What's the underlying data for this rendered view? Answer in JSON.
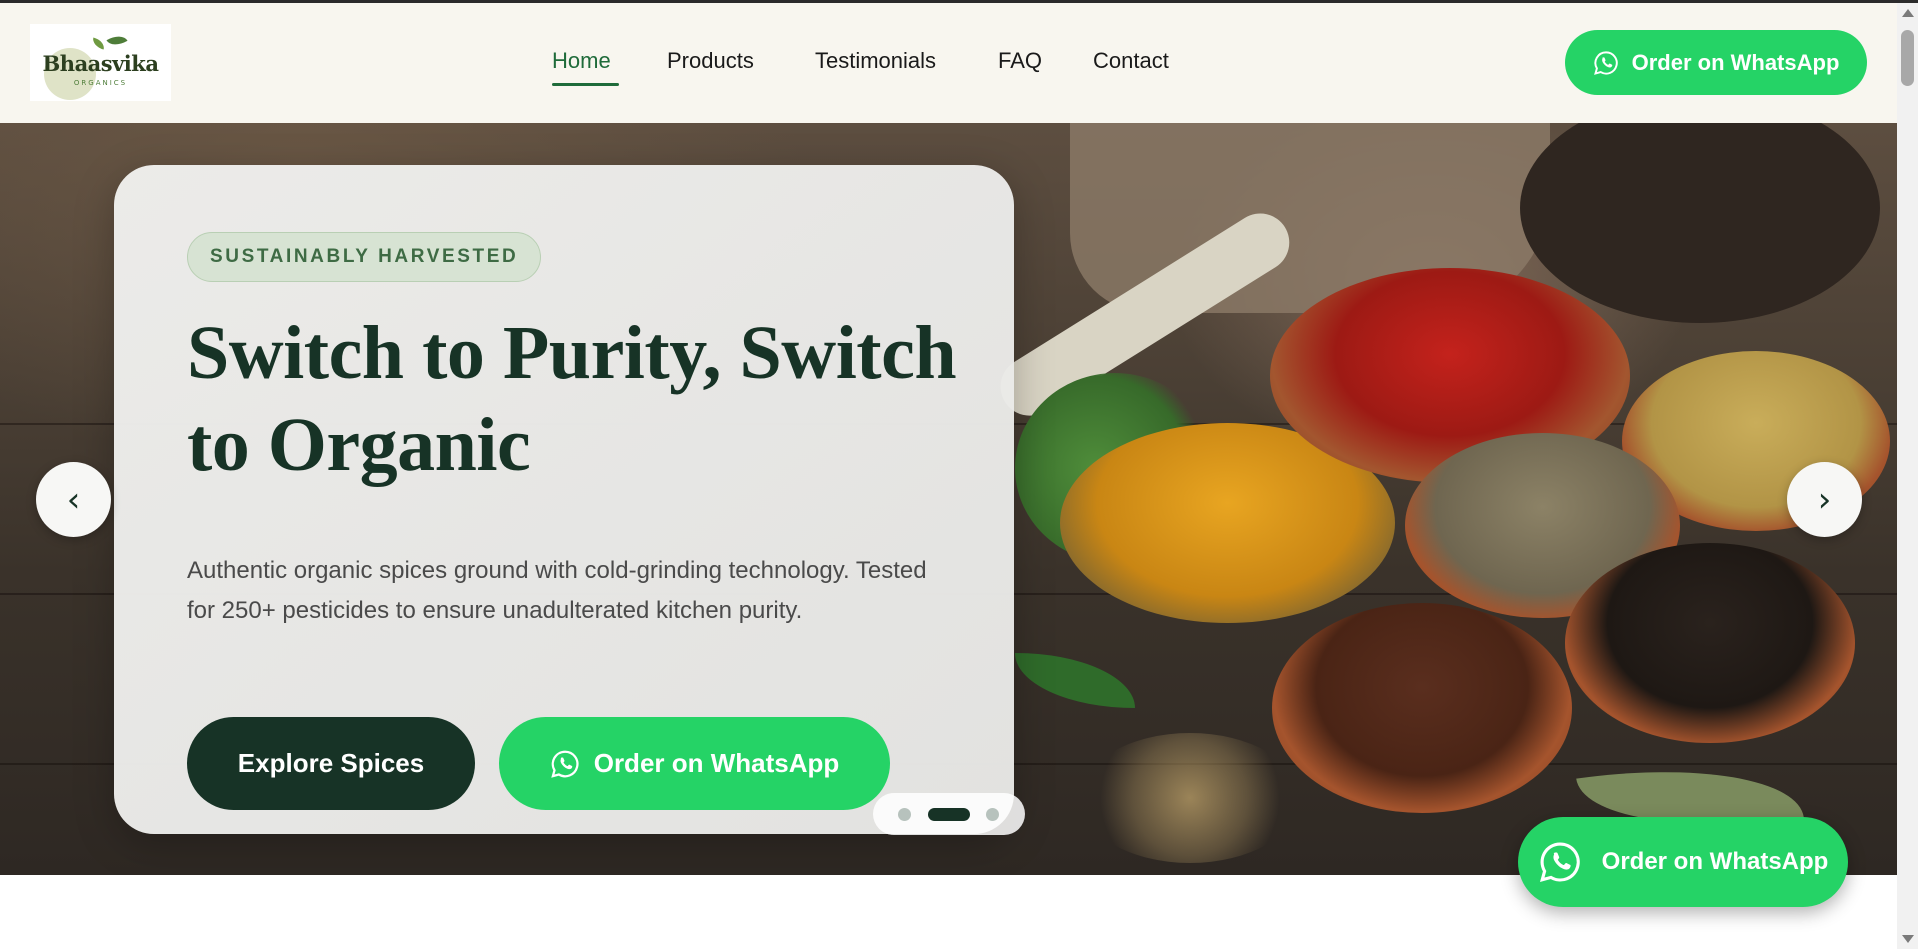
{
  "brand": {
    "name": "Bhaasvika",
    "tagline": "ORGANICS"
  },
  "nav": {
    "items": [
      {
        "label": "Home",
        "active": true
      },
      {
        "label": "Products",
        "active": false
      },
      {
        "label": "Testimonials",
        "active": false
      },
      {
        "label": "FAQ",
        "active": false
      },
      {
        "label": "Contact",
        "active": false
      }
    ],
    "cta_label": "Order on WhatsApp",
    "cta_icon": "whatsapp-icon"
  },
  "hero": {
    "badge": "SUSTAINABLY HARVESTED",
    "headline": "Switch to Purity, Switch to Organic",
    "description": "Authentic organic spices ground with cold-grinding technology. Tested for 250+ pesticides to ensure unadulterated kitchen purity.",
    "primary_button": "Explore Spices",
    "secondary_button": "Order on WhatsApp",
    "prev_label": "‹",
    "next_label": "›",
    "slide_count": 3,
    "active_slide": 2
  },
  "floating_cta": {
    "label": "Order on WhatsApp",
    "icon": "whatsapp-icon"
  },
  "colors": {
    "primary_dark": "#173326",
    "whatsapp_green": "#25d366",
    "accent_green": "#1f6b3a",
    "header_bg": "#f8f6ef"
  }
}
